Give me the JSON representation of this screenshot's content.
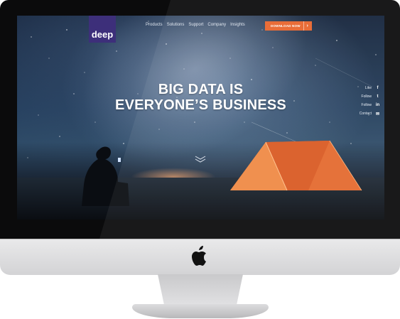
{
  "site": {
    "logo_text": "deep",
    "nav": [
      "Products",
      "Solutions",
      "Support",
      "Company",
      "Insights"
    ],
    "cta_label": "DOWNLOAD NOW",
    "cta_arrow": "›",
    "hero_line1": "BIG DATA IS",
    "hero_line2": "EVERYONE’S BUSINESS",
    "social": [
      {
        "label": "Like",
        "icon": "f",
        "icon_name": "facebook-icon"
      },
      {
        "label": "Follow",
        "icon": "t",
        "icon_name": "twitter-icon"
      },
      {
        "label": "Follow",
        "icon": "in",
        "icon_name": "linkedin-icon"
      },
      {
        "label": "Contact",
        "icon": "✉",
        "icon_name": "mail-icon"
      }
    ]
  },
  "colors": {
    "brand": "#3d2f7a",
    "cta": "#e8642c",
    "tent": "#e46a2e"
  },
  "device": {
    "logo_icon": "apple-logo-icon"
  }
}
